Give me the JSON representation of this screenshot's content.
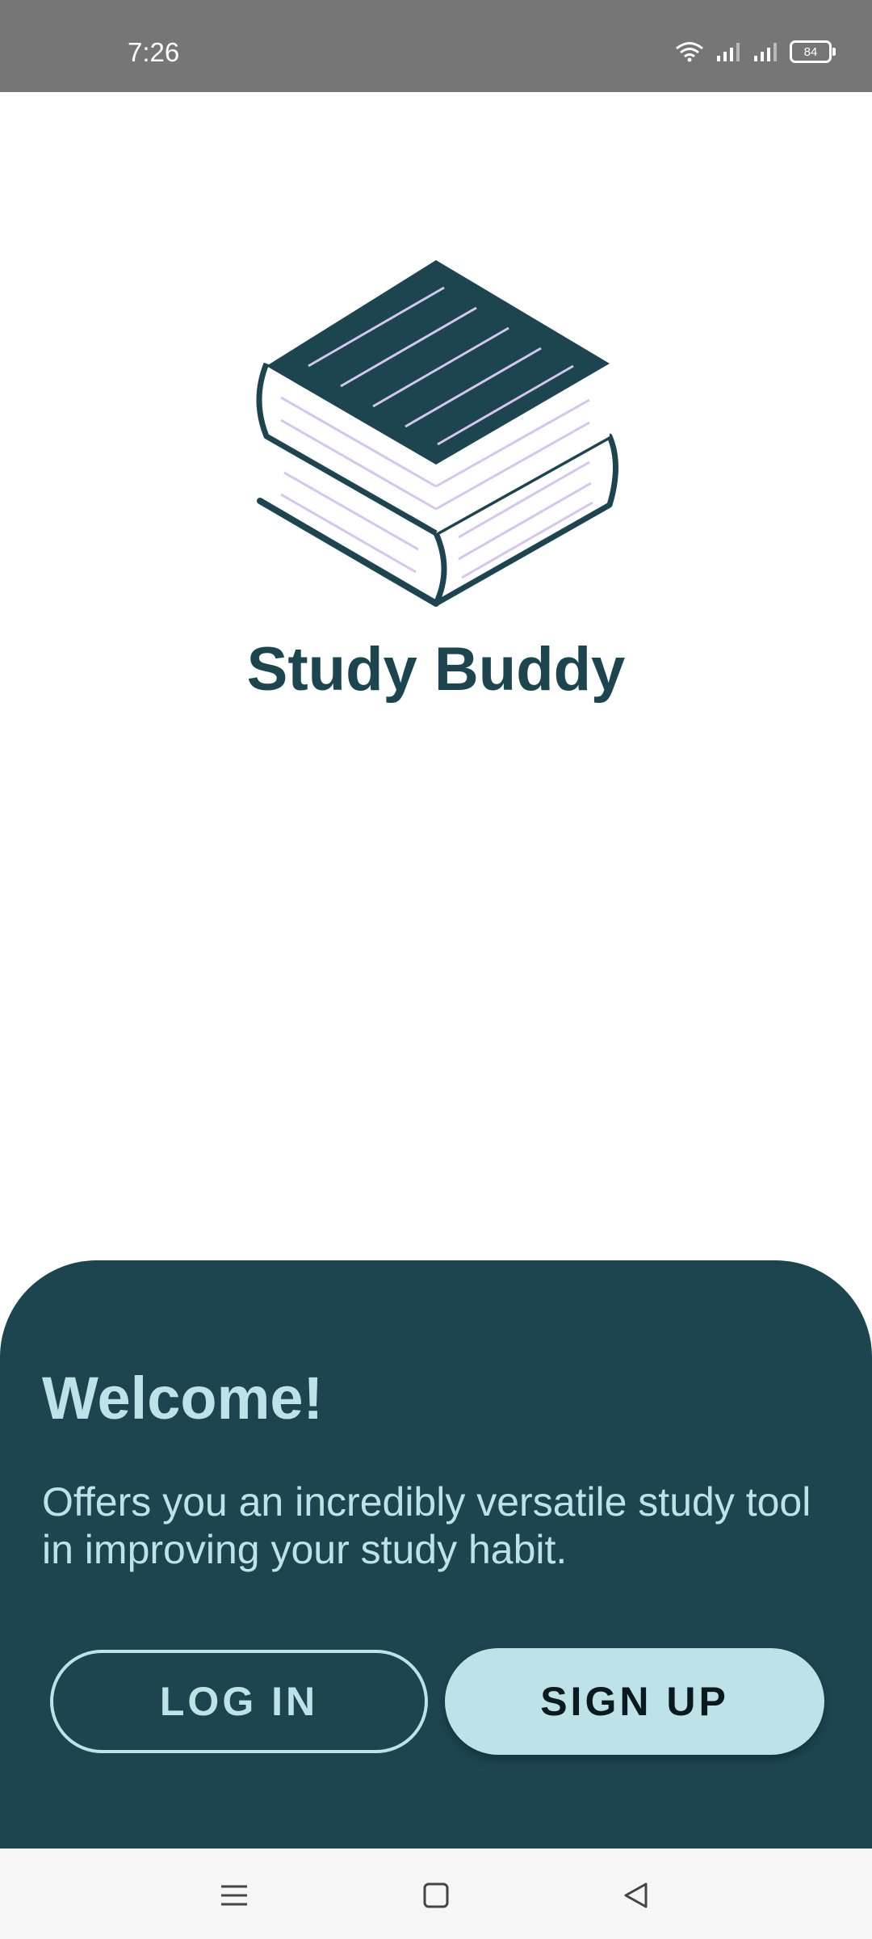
{
  "status_bar": {
    "time": "7:26",
    "battery_level": "84",
    "icons": [
      "wifi-icon",
      "signal-icon",
      "signal-icon",
      "battery-icon"
    ]
  },
  "app": {
    "name": "Study Buddy",
    "logo_icon": "book-stack-icon",
    "colors": {
      "primary": "#1c4550",
      "accent": "#bde3e8",
      "page_lines": "#d6c5ee"
    }
  },
  "welcome": {
    "title": "Welcome!",
    "description": "Offers you an incredibly versatile study tool in improving your study habit.",
    "login_label": "LOG IN",
    "signup_label": "SIGN UP"
  },
  "nav_bar": {
    "icons": [
      "menu-icon",
      "home-icon",
      "back-icon"
    ]
  }
}
